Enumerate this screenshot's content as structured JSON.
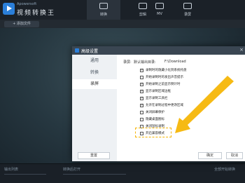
{
  "app": {
    "subtitle": "Apowersoft",
    "name": "视频转换王"
  },
  "nav": {
    "tabs": [
      {
        "label": "转换",
        "active": true
      },
      {
        "label": "剪辑",
        "active": false
      },
      {
        "label": "MV",
        "active": false
      },
      {
        "label": "录屏",
        "active": false
      }
    ]
  },
  "toolbar": {
    "add_file_label": "+ 添加文件"
  },
  "bottom": {
    "left_text": "输出列表",
    "middle_text": "转换后打开",
    "right_text": "全部开始转换"
  },
  "dialog": {
    "title": "高级设置",
    "close_glyph": "×",
    "sidebar": [
      "通用",
      "转换",
      "录屏"
    ],
    "active_sidebar": "录屏",
    "record_label": "录屏:",
    "dir_label": "默认输出目录:",
    "dir_value": "F:\\Download",
    "options": [
      {
        "label": "录制时的隐藏小化到系统托盘",
        "checked": true
      },
      {
        "label": "开始录制时的发出声音提示",
        "checked": false
      },
      {
        "label": "开始录制之前显示倒计时",
        "checked": true
      },
      {
        "label": "显示录制区域边框",
        "checked": true
      },
      {
        "label": "显示录制工具栏",
        "checked": true
      },
      {
        "label": "允许在录制过程中更改区域",
        "checked": true
      },
      {
        "label": "关闭屏幕保护",
        "checked": false
      },
      {
        "label": "隐藏桌面图标",
        "checked": false
      },
      {
        "label": "关闭鼠标录制",
        "checked": false
      },
      {
        "label": "开启兼容模式",
        "checked": false
      }
    ],
    "check_glyph": "✓",
    "reset_label": "重置",
    "ok_label": "确定",
    "cancel_label": "取消"
  },
  "annotation": {
    "color": "#f5b400"
  }
}
